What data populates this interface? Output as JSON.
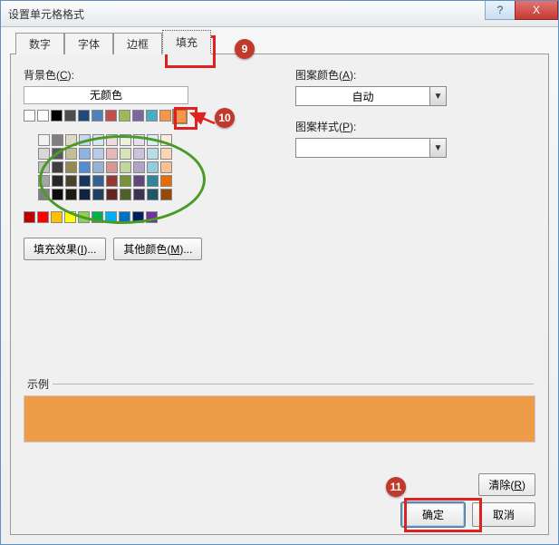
{
  "window": {
    "title": "设置单元格格式"
  },
  "caption": {
    "help_label": "?",
    "close_label": "X"
  },
  "tabs": [
    {
      "label": "数字"
    },
    {
      "label": "字体"
    },
    {
      "label": "边框"
    },
    {
      "label": "填充"
    }
  ],
  "active_tab_index": 3,
  "fill": {
    "bg_color_label": "背景色(",
    "bg_color_key": "C",
    "bg_color_label_end": "):",
    "no_color_label": "无颜色",
    "theme_row1": [
      "#ffffff",
      "#000000",
      "#4d4d4d",
      "#1f497d",
      "#4f81bd",
      "#c0504d",
      "#9bbb59",
      "#8064a2",
      "#4bacc6",
      "#f79646"
    ],
    "grid": [
      [
        "#f2f2f2",
        "#7f7f7f",
        "#ddd9c3",
        "#c6d9f0",
        "#dbe5f1",
        "#f2dcdb",
        "#ebf1dd",
        "#e5e0ec",
        "#dbeef3",
        "#fdeada"
      ],
      [
        "#d8d8d8",
        "#595959",
        "#c4bd97",
        "#8db3e2",
        "#b8cce4",
        "#e5b9b7",
        "#d7e3bc",
        "#ccc1d9",
        "#b7dde8",
        "#fbd5b5"
      ],
      [
        "#bfbfbf",
        "#3f3f3f",
        "#938953",
        "#548dd4",
        "#95b3d7",
        "#d99694",
        "#c3d69b",
        "#b2a2c7",
        "#92cddc",
        "#fac08f"
      ],
      [
        "#a5a5a5",
        "#262626",
        "#494429",
        "#17365d",
        "#366092",
        "#953734",
        "#76923c",
        "#5f497a",
        "#31859b",
        "#e36c09"
      ],
      [
        "#7f7f7f",
        "#0c0c0c",
        "#1d1b10",
        "#0f243e",
        "#244061",
        "#632423",
        "#4f6128",
        "#3f3151",
        "#205867",
        "#974806"
      ]
    ],
    "standard_row": [
      "#c00000",
      "#ff0000",
      "#ffc000",
      "#ffff00",
      "#92d050",
      "#00b050",
      "#00b0f0",
      "#0070c0",
      "#002060",
      "#7030a0"
    ],
    "selected_color": "#f79646",
    "fill_effects_button": "填充效果(",
    "fill_effects_key": "I",
    "fill_effects_end": ")...",
    "more_colors_button": "其他颜色(",
    "more_colors_key": "M",
    "more_colors_end": ")..."
  },
  "pattern": {
    "color_label": "图案颜色(",
    "color_key": "A",
    "color_label_end": "):",
    "color_selected": "自动",
    "style_label": "图案样式(",
    "style_key": "P",
    "style_label_end": "):",
    "style_selected": ""
  },
  "example": {
    "legend": "示例",
    "color": "#ef9c49"
  },
  "buttons": {
    "clear": "清除(",
    "clear_key": "R",
    "clear_end": ")",
    "ok": "确定",
    "cancel": "取消"
  },
  "annotations": {
    "b9": "9",
    "b10": "10",
    "b11": "11"
  }
}
